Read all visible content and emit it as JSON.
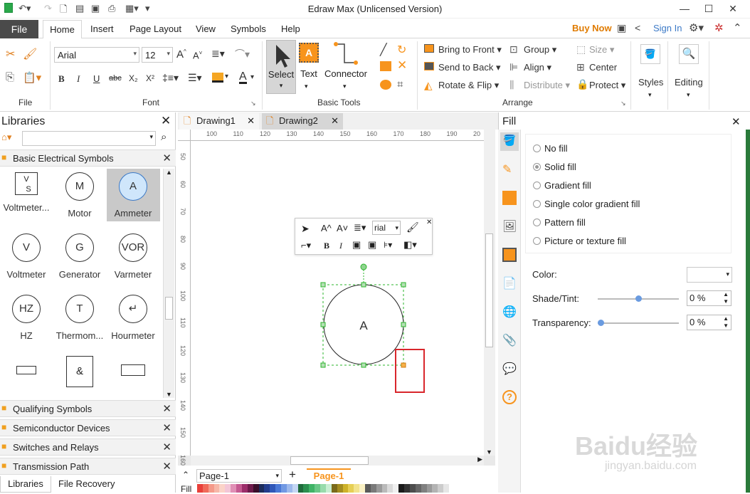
{
  "window": {
    "title": "Edraw Max (Unlicensed Version)"
  },
  "tabs": {
    "file": "File",
    "home": "Home",
    "insert": "Insert",
    "page_layout": "Page Layout",
    "view": "View",
    "symbols": "Symbols",
    "help": "Help"
  },
  "account": {
    "buy_now": "Buy Now",
    "sign_in": "Sign In"
  },
  "ribbon": {
    "groups": {
      "file": "File",
      "font": "Font",
      "basic_tools": "Basic Tools",
      "arrange": "Arrange"
    },
    "font_name": "Arial",
    "font_size": "12",
    "select": "Select",
    "text": "Text",
    "connector": "Connector",
    "bring_to_front": "Bring to Front",
    "send_to_back": "Send to Back",
    "rotate_flip": "Rotate & Flip",
    "group": "Group",
    "align": "Align",
    "distribute": "Distribute",
    "size": "Size",
    "center": "Center",
    "protect": "Protect",
    "styles": "Styles",
    "editing": "Editing"
  },
  "libraries": {
    "title": "Libraries",
    "section_open": "Basic Electrical Symbols",
    "symbols": [
      {
        "glyph": "V/S",
        "label": "Voltmeter..."
      },
      {
        "glyph": "M",
        "label": "Motor"
      },
      {
        "glyph": "A",
        "label": "Ammeter"
      },
      {
        "glyph": "V",
        "label": "Voltmeter"
      },
      {
        "glyph": "G",
        "label": "Generator"
      },
      {
        "glyph": "VOR",
        "label": "Varmeter"
      },
      {
        "glyph": "HZ",
        "label": "HZ"
      },
      {
        "glyph": "T",
        "label": "Thermom..."
      },
      {
        "glyph": "↵",
        "label": "Hourmeter"
      },
      {
        "glyph": "",
        "label": ""
      },
      {
        "glyph": "&",
        "label": ""
      },
      {
        "glyph": "",
        "label": ""
      }
    ],
    "sections": [
      "Qualifying Symbols",
      "Semiconductor Devices",
      "Switches and Relays",
      "Transmission Path"
    ],
    "bottom_tabs": [
      "Libraries",
      "File Recovery"
    ]
  },
  "documents": {
    "tabs": [
      "Drawing1",
      "Drawing2"
    ]
  },
  "ruler": {
    "h": [
      "100",
      "110",
      "120",
      "130",
      "140",
      "150",
      "160",
      "170",
      "180",
      "190",
      "20"
    ],
    "v": [
      "50",
      "60",
      "70",
      "80",
      "90",
      "100",
      "110",
      "120",
      "130",
      "140",
      "150",
      "160"
    ]
  },
  "canvas": {
    "shape_label": "A",
    "minitoolbar_font": "rial"
  },
  "pages": {
    "current": "Page-1",
    "tab": "Page-1"
  },
  "fill_label": "Fill",
  "fill_panel": {
    "title": "Fill",
    "options": [
      "No fill",
      "Solid fill",
      "Gradient fill",
      "Single color gradient fill",
      "Pattern fill",
      "Picture or texture fill"
    ],
    "selected": "Solid fill",
    "color_label": "Color:",
    "shade_label": "Shade/Tint:",
    "shade_value": "0 %",
    "transparency_label": "Transparency:",
    "transparency_value": "0 %"
  },
  "watermark": {
    "brand": "Baidu经验",
    "url": "jingyan.baidu.com"
  },
  "colors": {
    "accent": "#3c7ac7",
    "orange": "#f7941d",
    "buy_now": "#e07b00",
    "highlight": "#d9262c",
    "selection": "#2bb52b"
  }
}
